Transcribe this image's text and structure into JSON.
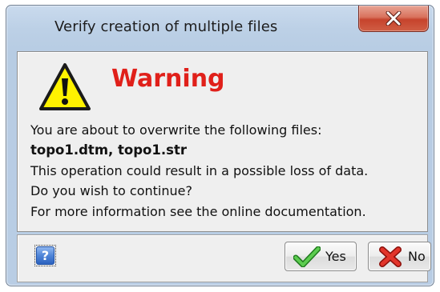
{
  "window": {
    "title": "Verify creation of multiple files"
  },
  "message": {
    "heading": "Warning",
    "lines": [
      "You are about to overwrite the following files:",
      "topo1.dtm, topo1.str",
      "This operation could result in a possible loss of data.",
      "Do you wish to continue?",
      "For more information see the online documentation."
    ]
  },
  "buttons": {
    "help_label": "?",
    "yes_label": "Yes",
    "no_label": "No"
  },
  "icons": {
    "close": "close-x-icon",
    "warning": "warning-triangle-icon",
    "help": "help-question-icon",
    "yes": "green-check-icon",
    "no": "red-x-icon"
  },
  "colors": {
    "heading": "#e0201a",
    "close_button": "#c6432c",
    "warning_fill": "#fff200",
    "check": "#3db23a",
    "cross": "#d9241c"
  }
}
